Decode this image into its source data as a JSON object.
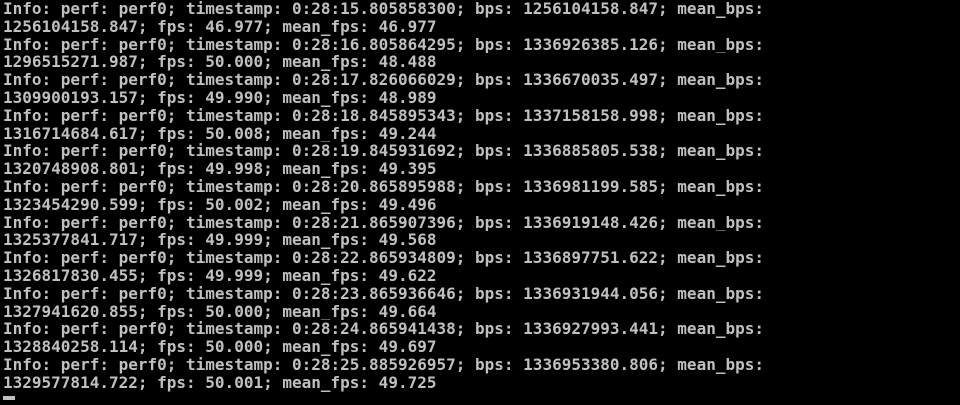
{
  "console": {
    "lines": [
      "Info: perf: perf0; timestamp: 0:28:15.805858300; bps: 1256104158.847; mean_bps:",
      "1256104158.847; fps: 46.977; mean_fps: 46.977",
      "Info: perf: perf0; timestamp: 0:28:16.805864295; bps: 1336926385.126; mean_bps:",
      "1296515271.987; fps: 50.000; mean_fps: 48.488",
      "Info: perf: perf0; timestamp: 0:28:17.826066029; bps: 1336670035.497; mean_bps:",
      "1309900193.157; fps: 49.990; mean_fps: 48.989",
      "Info: perf: perf0; timestamp: 0:28:18.845895343; bps: 1337158158.998; mean_bps:",
      "1316714684.617; fps: 50.008; mean_fps: 49.244",
      "Info: perf: perf0; timestamp: 0:28:19.845931692; bps: 1336885805.538; mean_bps:",
      "1320748908.801; fps: 49.998; mean_fps: 49.395",
      "Info: perf: perf0; timestamp: 0:28:20.865895988; bps: 1336981199.585; mean_bps:",
      "1323454290.599; fps: 50.002; mean_fps: 49.496",
      "Info: perf: perf0; timestamp: 0:28:21.865907396; bps: 1336919148.426; mean_bps:",
      "1325377841.717; fps: 49.999; mean_fps: 49.568",
      "Info: perf: perf0; timestamp: 0:28:22.865934809; bps: 1336897751.622; mean_bps:",
      "1326817830.455; fps: 49.999; mean_fps: 49.622",
      "Info: perf: perf0; timestamp: 0:28:23.865936646; bps: 1336931944.056; mean_bps:",
      "1327941620.855; fps: 50.000; mean_fps: 49.664",
      "Info: perf: perf0; timestamp: 0:28:24.865941438; bps: 1336927993.441; mean_bps:",
      "1328840258.114; fps: 50.000; mean_fps: 49.697",
      "Info: perf: perf0; timestamp: 0:28:25.885926957; bps: 1336953380.806; mean_bps:",
      "1329577814.722; fps: 50.001; mean_fps: 49.725"
    ]
  },
  "colors": {
    "background": "#000000",
    "text": "#c0c0c0"
  }
}
